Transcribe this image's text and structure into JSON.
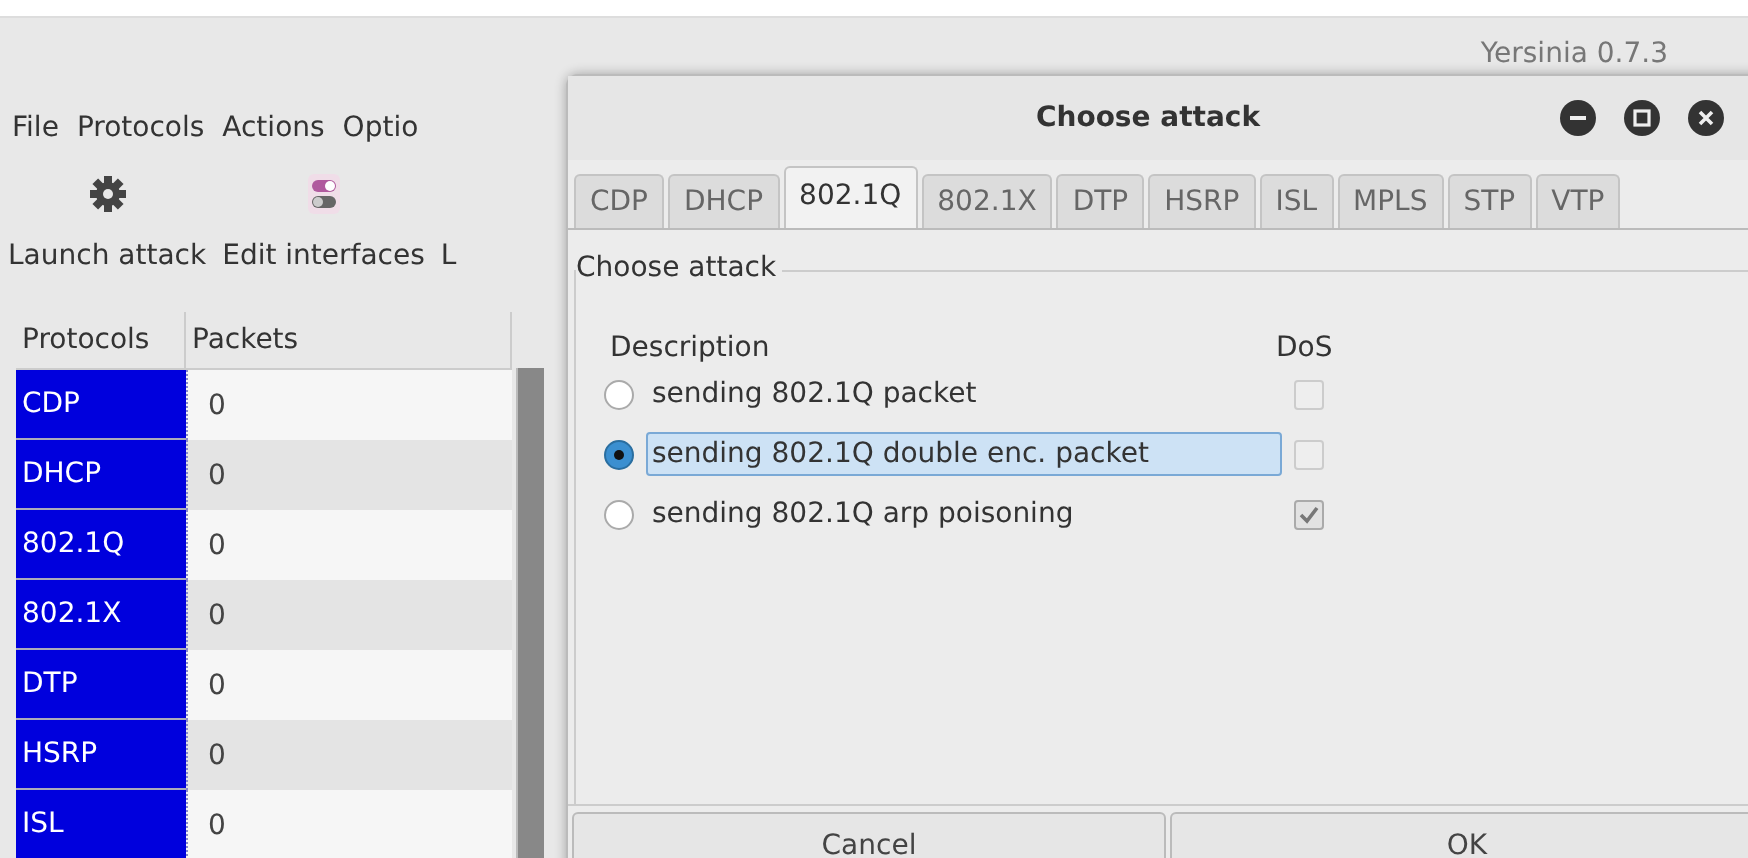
{
  "app": {
    "title": "Yersinia 0.7.3",
    "menu": [
      "File",
      "Protocols",
      "Actions",
      "Optio"
    ],
    "toolbar": [
      {
        "kind": "gear",
        "label": "Launch attack"
      },
      {
        "kind": "toggle",
        "label": "Edit interfaces"
      },
      {
        "kind": "none",
        "label": "L"
      }
    ]
  },
  "table": {
    "columns": [
      "Protocols",
      "Packets"
    ],
    "rows": [
      {
        "protocol": "CDP",
        "packets": "0"
      },
      {
        "protocol": "DHCP",
        "packets": "0"
      },
      {
        "protocol": "802.1Q",
        "packets": "0"
      },
      {
        "protocol": "802.1X",
        "packets": "0"
      },
      {
        "protocol": "DTP",
        "packets": "0"
      },
      {
        "protocol": "HSRP",
        "packets": "0"
      },
      {
        "protocol": "ISL",
        "packets": "0"
      }
    ]
  },
  "dialog": {
    "title": "Choose attack",
    "tabs": [
      {
        "label": "CDP",
        "selected": false
      },
      {
        "label": "DHCP",
        "selected": false
      },
      {
        "label": "802.1Q",
        "selected": true
      },
      {
        "label": "802.1X",
        "selected": false
      },
      {
        "label": "DTP",
        "selected": false
      },
      {
        "label": "HSRP",
        "selected": false
      },
      {
        "label": "ISL",
        "selected": false
      },
      {
        "label": "MPLS",
        "selected": false
      },
      {
        "label": "STP",
        "selected": false
      },
      {
        "label": "VTP",
        "selected": false
      }
    ],
    "frame_title": "Choose attack",
    "columns": [
      "Description",
      "DoS"
    ],
    "attacks": [
      {
        "description": "sending 802.1Q packet",
        "selected": false,
        "dos": false
      },
      {
        "description": "sending 802.1Q double enc. packet",
        "selected": true,
        "dos": false
      },
      {
        "description": "sending 802.1Q arp poisoning",
        "selected": false,
        "dos": true
      }
    ],
    "buttons": [
      "Cancel",
      "OK"
    ]
  }
}
